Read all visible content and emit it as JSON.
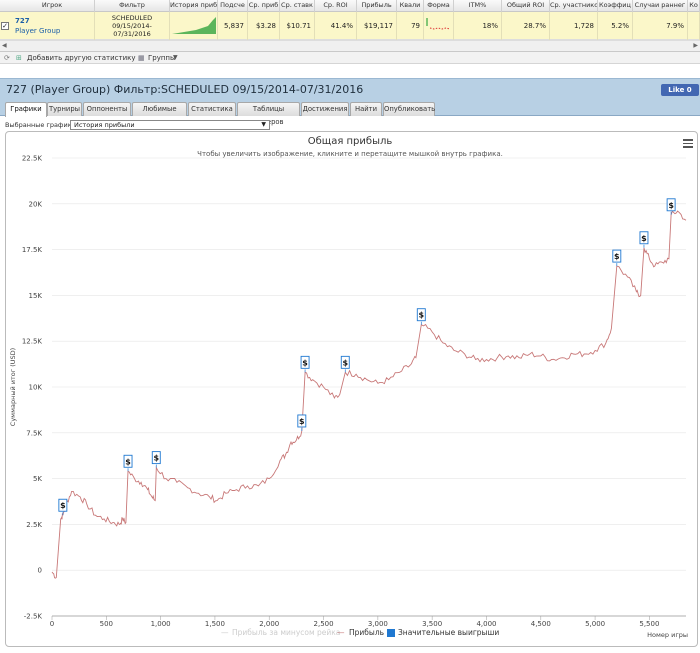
{
  "grid": {
    "headers": [
      "Игрок",
      "Фильтр",
      "История приб",
      "Подсче",
      "Ср. приб",
      "Ср. ставк",
      "Ср. ROI",
      "Прибыль",
      "Квали",
      "Форма",
      "ITM%",
      "Общий ROI",
      "Ср. участнико",
      "Коэффиц",
      "Случаи раннег",
      "Ко"
    ],
    "row": {
      "checked": "✓",
      "player_id": "727",
      "player_name": "Player Group",
      "filter_lines": [
        "SCHEDULED",
        "09/15/2014-",
        "07/31/2016"
      ],
      "count": "5,837",
      "avg_profit": "$3.28",
      "avg_stake": "$10.71",
      "avg_roi": "41.4%",
      "profit": "$19,117",
      "qual": "79",
      "itm": "18%",
      "total_roi": "28.7%",
      "avg_participants": "1,728",
      "coef": "5.2%",
      "early": "7.9%"
    },
    "footer": {
      "add_stat": "Добавить другую статистику",
      "groups": "Группы"
    }
  },
  "page": {
    "title": "727 (Player Group) Фильтр:SCHEDULED 09/15/2014-07/31/2016",
    "fb_like": "Like 0"
  },
  "tabs": [
    "Графики",
    "Турниры",
    "Оппоненты",
    "Любимые игры",
    "Статистика",
    "Таблицы лидеров",
    "Достижения",
    "Найти",
    "Опубликовать"
  ],
  "active_tab": 0,
  "chart_selector": {
    "label": "Выбранные графики:",
    "value": "История прибыли"
  },
  "chart_data": {
    "type": "line",
    "title": "Общая прибыль",
    "subtitle": "Чтобы увеличить изображение, кликните и перетащите мышкой внутрь графика.",
    "xlabel": "Номер игры",
    "ylabel": "Суммарный итог (USD)",
    "xlim": [
      0,
      5837
    ],
    "ylim": [
      -2500,
      22500
    ],
    "x_ticks": [
      "0",
      "500",
      "1,000",
      "1,500",
      "2,000",
      "2,500",
      "3,000",
      "3,500",
      "4,000",
      "4,500",
      "5,000",
      "5,500"
    ],
    "y_ticks": [
      "-2.5K",
      "0",
      "2.5K",
      "5K",
      "7.5K",
      "10K",
      "12.5K",
      "15K",
      "17.5K",
      "20K",
      "22.5K"
    ],
    "legend": [
      {
        "name": "Прибыль за минусом рейка",
        "color": "#cccccc",
        "visible": false
      },
      {
        "name": "Прибыль",
        "color": "#c87878",
        "visible": true
      },
      {
        "name": "Значительные выигрыши",
        "color": "#1f78d1",
        "visible": true
      }
    ],
    "series": [
      {
        "name": "Прибыль",
        "color": "#c87878",
        "points": [
          [
            0,
            -0.1
          ],
          [
            40,
            -0.4
          ],
          [
            60,
            1.2
          ],
          [
            80,
            2.8
          ],
          [
            100,
            3.0
          ],
          [
            130,
            3.6
          ],
          [
            180,
            4.3
          ],
          [
            260,
            4.0
          ],
          [
            320,
            3.6
          ],
          [
            400,
            3.0
          ],
          [
            480,
            2.8
          ],
          [
            560,
            2.6
          ],
          [
            620,
            2.5
          ],
          [
            650,
            2.8
          ],
          [
            680,
            2.6
          ],
          [
            700,
            5.4
          ],
          [
            760,
            5.0
          ],
          [
            820,
            4.8
          ],
          [
            880,
            4.4
          ],
          [
            920,
            4.0
          ],
          [
            950,
            3.8
          ],
          [
            960,
            5.6
          ],
          [
            1050,
            5.0
          ],
          [
            1150,
            4.8
          ],
          [
            1250,
            4.5
          ],
          [
            1350,
            4.2
          ],
          [
            1450,
            4.0
          ],
          [
            1520,
            3.8
          ],
          [
            1600,
            4.2
          ],
          [
            1700,
            4.4
          ],
          [
            1800,
            4.6
          ],
          [
            1900,
            4.6
          ],
          [
            2000,
            5.0
          ],
          [
            2100,
            6.0
          ],
          [
            2150,
            6.3
          ],
          [
            2200,
            7.0
          ],
          [
            2250,
            7.1
          ],
          [
            2300,
            7.6
          ],
          [
            2330,
            10.8
          ],
          [
            2400,
            10.4
          ],
          [
            2500,
            10.0
          ],
          [
            2600,
            9.4
          ],
          [
            2650,
            9.6
          ],
          [
            2700,
            10.8
          ],
          [
            2800,
            10.7
          ],
          [
            2900,
            10.4
          ],
          [
            3000,
            10.2
          ],
          [
            3100,
            10.4
          ],
          [
            3200,
            10.8
          ],
          [
            3300,
            11.2
          ],
          [
            3350,
            11.6
          ],
          [
            3400,
            13.4
          ],
          [
            3500,
            13.0
          ],
          [
            3600,
            12.4
          ],
          [
            3700,
            12.0
          ],
          [
            3800,
            11.8
          ],
          [
            3900,
            11.5
          ],
          [
            4000,
            11.5
          ],
          [
            4100,
            11.6
          ],
          [
            4200,
            11.7
          ],
          [
            4300,
            11.6
          ],
          [
            4400,
            11.8
          ],
          [
            4500,
            11.7
          ],
          [
            4600,
            11.5
          ],
          [
            4700,
            11.6
          ],
          [
            4800,
            11.8
          ],
          [
            4900,
            11.8
          ],
          [
            5000,
            12.0
          ],
          [
            5100,
            12.4
          ],
          [
            5150,
            13.2
          ],
          [
            5200,
            16.6
          ],
          [
            5300,
            16.0
          ],
          [
            5380,
            15.2
          ],
          [
            5420,
            15.0
          ],
          [
            5450,
            17.6
          ],
          [
            5500,
            17.0
          ],
          [
            5550,
            16.6
          ],
          [
            5620,
            16.8
          ],
          [
            5680,
            17.0
          ],
          [
            5700,
            19.4
          ],
          [
            5760,
            19.6
          ],
          [
            5837,
            19.1
          ]
        ]
      }
    ],
    "big_wins": [
      [
        100,
        3.0
      ],
      [
        700,
        5.4
      ],
      [
        960,
        5.6
      ],
      [
        2300,
        7.6
      ],
      [
        2330,
        10.8
      ],
      [
        2700,
        10.8
      ],
      [
        3400,
        13.4
      ],
      [
        5200,
        16.6
      ],
      [
        5450,
        17.6
      ],
      [
        5700,
        19.4
      ]
    ],
    "marker_label": "$"
  }
}
